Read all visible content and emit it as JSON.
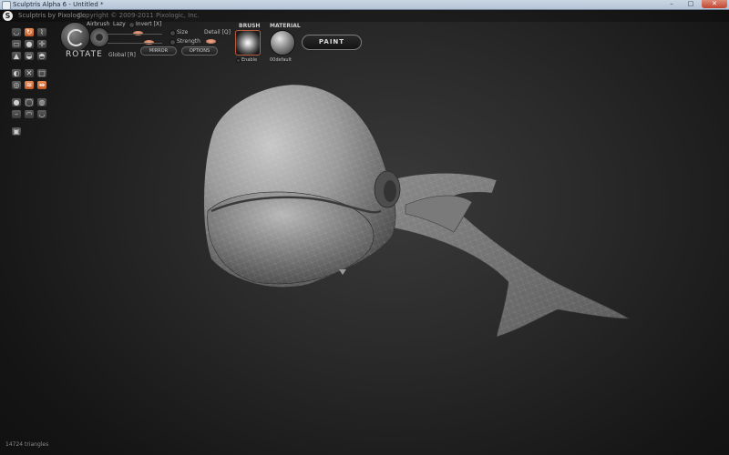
{
  "window": {
    "title": "Sculptris Alpha 6 - Untitled *",
    "minimize_glyph": "–",
    "maximize_glyph": "□",
    "close_glyph": "✕"
  },
  "header": {
    "logo_glyph": "S",
    "app_name": "Sculptris by Pixologic",
    "copyright": "Copyright © 2009-2011 Pixologic, Inc."
  },
  "tools": {
    "icons": [
      "tool-draw-icon",
      "tool-rotate-icon",
      "tool-crease-icon",
      "tool-flatten-icon",
      "tool-inflate-icon",
      "tool-pinch-icon",
      "tool-grab-icon",
      "tool-smooth-icon",
      "tool-reduce-icon",
      "tool-symmetry-icon",
      "tool-wireframe-icon",
      "tool-view-icon",
      "tool-tesselate-icon",
      "tool-mask-icon",
      "tool-paint-icon",
      "tool-light-icon",
      "tool-sphere-icon",
      "tool-plane-icon",
      "tool-undo-icon",
      "tool-redo-icon",
      "tool-save-icon",
      "tool-camera-icon"
    ]
  },
  "brush_panel": {
    "mode_label": "ROTATE",
    "airbrush_label": "Airbrush",
    "lazy_label": "Lazy",
    "invert_label": "Invert [X]",
    "size_label": "Size",
    "strength_label": "Strength",
    "detail_label": "Detail [Q]",
    "global_label": "Global [R]",
    "mirror_label": "MIRROR",
    "options_label": "OPTIONS"
  },
  "brush": {
    "title": "BRUSH",
    "enable_label": "Enable"
  },
  "material": {
    "title": "MATERIAL",
    "name": "00default"
  },
  "paint_button": "PAINT",
  "status": {
    "triangles": "14724 triangles"
  },
  "colors": {
    "accent": "#d4703a",
    "background": "#1a1a1a",
    "model": "#9a9a9a"
  }
}
